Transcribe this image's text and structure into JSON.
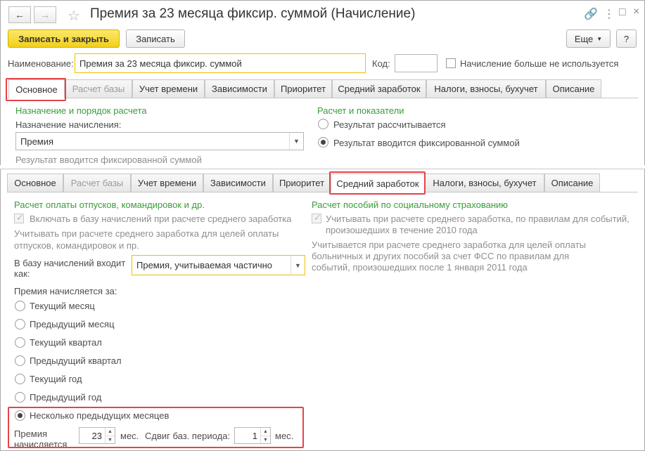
{
  "window": {
    "title": "Премия за 23 месяца фиксир. суммой (Начисление)"
  },
  "toolbar": {
    "save_close_label": "Записать и закрыть",
    "save_label": "Записать",
    "more_label": "Еще",
    "help_label": "?"
  },
  "form": {
    "name_label": "Наименование:",
    "name_value": "Премия за 23 месяца фиксир. суммой",
    "code_label": "Код:",
    "code_value": "",
    "unused_label": "Начисление больше не используется"
  },
  "tabs_top": [
    "Основное",
    "Расчет базы",
    "Учет времени",
    "Зависимости",
    "Приоритет",
    "Средний заработок",
    "Налоги, взносы, бухучет",
    "Описание"
  ],
  "main_tab": {
    "purpose_section": "Назначение и порядок расчета",
    "purpose_label": "Назначение начисления:",
    "purpose_value": "Премия",
    "fixed_hint": "Результат вводится фиксированной суммой",
    "calc_section": "Расчет и показатели",
    "radio_calculated": "Результат рассчитывается",
    "radio_fixed": "Результат вводится фиксированной суммой"
  },
  "tabs_bottom": [
    "Основное",
    "Расчет базы",
    "Учет времени",
    "Зависимости",
    "Приоритет",
    "Средний заработок",
    "Налоги, взносы, бухучет",
    "Описание"
  ],
  "avg_tab": {
    "vacation_section": "Расчет оплаты отпусков, командировок и др.",
    "include_label": "Включать в базу начислений при расчете среднего заработка",
    "note_line1": "Учитывать при расчете среднего заработка для целей оплаты",
    "note_line2": "отпусков, командировок и пр.",
    "base_label_line1": "В базу начислений входит",
    "base_label_line2": "как:",
    "base_value": "Премия, учитываемая частично",
    "period_label": "Премия начисляется за:",
    "period_options": [
      "Текущий месяц",
      "Предыдущий месяц",
      "Текущий квартал",
      "Предыдущий квартал",
      "Текущий год",
      "Предыдущий год",
      "Несколько предыдущих месяцев"
    ],
    "selected_period": "Несколько предыдущих месяцев",
    "accrued_label_line1": "Премия",
    "accrued_label_line2": "начисляется",
    "months_value": "23",
    "months_unit": "мес.",
    "shift_label": "Сдвиг баз. периода:",
    "shift_value": "1",
    "shift_unit": "мес.",
    "fss_section": "Расчет пособий по социальному страхованию",
    "fss_check_line1": "Учитывать при расчете среднего заработка, по правилам для событий,",
    "fss_check_line2": "произошедших в течение 2010 года",
    "fss_note_line1": "Учитывается при расчете среднего заработка для целей оплаты",
    "fss_note_line2": "больничных и других пособий за счет ФСС по правилам для",
    "fss_note_line3": "событий, произошедших после 1 января 2011 года"
  },
  "colors": {
    "highlight": "#e4444a",
    "section": "#3a9c3a",
    "primary_button": "#f2cf1a",
    "focus_border": "#f0c000"
  }
}
